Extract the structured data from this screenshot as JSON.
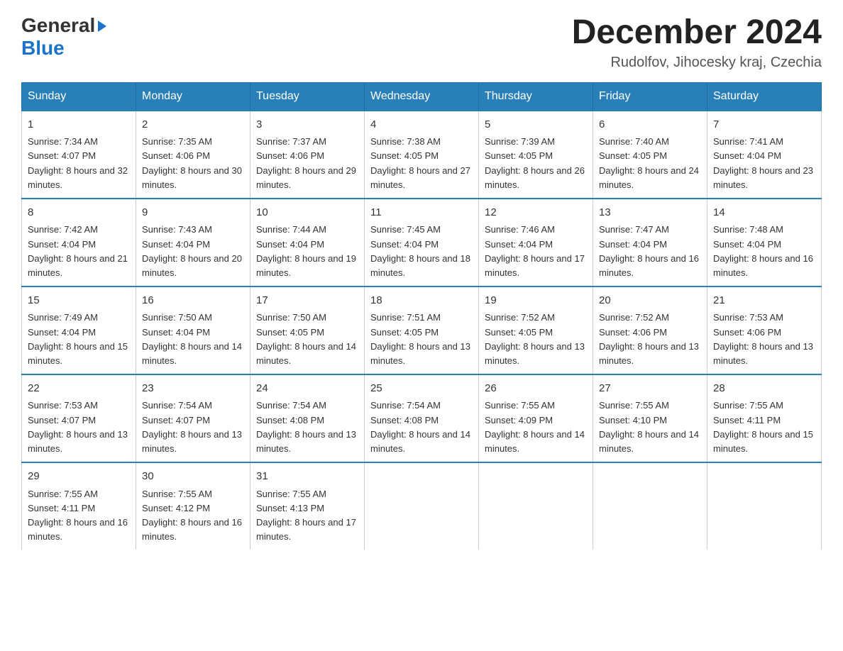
{
  "header": {
    "logo_general": "General",
    "logo_blue": "Blue",
    "month_title": "December 2024",
    "location": "Rudolfov, Jihocesky kraj, Czechia"
  },
  "days_of_week": [
    "Sunday",
    "Monday",
    "Tuesday",
    "Wednesday",
    "Thursday",
    "Friday",
    "Saturday"
  ],
  "weeks": [
    [
      {
        "num": "1",
        "sunrise": "7:34 AM",
        "sunset": "4:07 PM",
        "daylight": "8 hours and 32 minutes."
      },
      {
        "num": "2",
        "sunrise": "7:35 AM",
        "sunset": "4:06 PM",
        "daylight": "8 hours and 30 minutes."
      },
      {
        "num": "3",
        "sunrise": "7:37 AM",
        "sunset": "4:06 PM",
        "daylight": "8 hours and 29 minutes."
      },
      {
        "num": "4",
        "sunrise": "7:38 AM",
        "sunset": "4:05 PM",
        "daylight": "8 hours and 27 minutes."
      },
      {
        "num": "5",
        "sunrise": "7:39 AM",
        "sunset": "4:05 PM",
        "daylight": "8 hours and 26 minutes."
      },
      {
        "num": "6",
        "sunrise": "7:40 AM",
        "sunset": "4:05 PM",
        "daylight": "8 hours and 24 minutes."
      },
      {
        "num": "7",
        "sunrise": "7:41 AM",
        "sunset": "4:04 PM",
        "daylight": "8 hours and 23 minutes."
      }
    ],
    [
      {
        "num": "8",
        "sunrise": "7:42 AM",
        "sunset": "4:04 PM",
        "daylight": "8 hours and 21 minutes."
      },
      {
        "num": "9",
        "sunrise": "7:43 AM",
        "sunset": "4:04 PM",
        "daylight": "8 hours and 20 minutes."
      },
      {
        "num": "10",
        "sunrise": "7:44 AM",
        "sunset": "4:04 PM",
        "daylight": "8 hours and 19 minutes."
      },
      {
        "num": "11",
        "sunrise": "7:45 AM",
        "sunset": "4:04 PM",
        "daylight": "8 hours and 18 minutes."
      },
      {
        "num": "12",
        "sunrise": "7:46 AM",
        "sunset": "4:04 PM",
        "daylight": "8 hours and 17 minutes."
      },
      {
        "num": "13",
        "sunrise": "7:47 AM",
        "sunset": "4:04 PM",
        "daylight": "8 hours and 16 minutes."
      },
      {
        "num": "14",
        "sunrise": "7:48 AM",
        "sunset": "4:04 PM",
        "daylight": "8 hours and 16 minutes."
      }
    ],
    [
      {
        "num": "15",
        "sunrise": "7:49 AM",
        "sunset": "4:04 PM",
        "daylight": "8 hours and 15 minutes."
      },
      {
        "num": "16",
        "sunrise": "7:50 AM",
        "sunset": "4:04 PM",
        "daylight": "8 hours and 14 minutes."
      },
      {
        "num": "17",
        "sunrise": "7:50 AM",
        "sunset": "4:05 PM",
        "daylight": "8 hours and 14 minutes."
      },
      {
        "num": "18",
        "sunrise": "7:51 AM",
        "sunset": "4:05 PM",
        "daylight": "8 hours and 13 minutes."
      },
      {
        "num": "19",
        "sunrise": "7:52 AM",
        "sunset": "4:05 PM",
        "daylight": "8 hours and 13 minutes."
      },
      {
        "num": "20",
        "sunrise": "7:52 AM",
        "sunset": "4:06 PM",
        "daylight": "8 hours and 13 minutes."
      },
      {
        "num": "21",
        "sunrise": "7:53 AM",
        "sunset": "4:06 PM",
        "daylight": "8 hours and 13 minutes."
      }
    ],
    [
      {
        "num": "22",
        "sunrise": "7:53 AM",
        "sunset": "4:07 PM",
        "daylight": "8 hours and 13 minutes."
      },
      {
        "num": "23",
        "sunrise": "7:54 AM",
        "sunset": "4:07 PM",
        "daylight": "8 hours and 13 minutes."
      },
      {
        "num": "24",
        "sunrise": "7:54 AM",
        "sunset": "4:08 PM",
        "daylight": "8 hours and 13 minutes."
      },
      {
        "num": "25",
        "sunrise": "7:54 AM",
        "sunset": "4:08 PM",
        "daylight": "8 hours and 14 minutes."
      },
      {
        "num": "26",
        "sunrise": "7:55 AM",
        "sunset": "4:09 PM",
        "daylight": "8 hours and 14 minutes."
      },
      {
        "num": "27",
        "sunrise": "7:55 AM",
        "sunset": "4:10 PM",
        "daylight": "8 hours and 14 minutes."
      },
      {
        "num": "28",
        "sunrise": "7:55 AM",
        "sunset": "4:11 PM",
        "daylight": "8 hours and 15 minutes."
      }
    ],
    [
      {
        "num": "29",
        "sunrise": "7:55 AM",
        "sunset": "4:11 PM",
        "daylight": "8 hours and 16 minutes."
      },
      {
        "num": "30",
        "sunrise": "7:55 AM",
        "sunset": "4:12 PM",
        "daylight": "8 hours and 16 minutes."
      },
      {
        "num": "31",
        "sunrise": "7:55 AM",
        "sunset": "4:13 PM",
        "daylight": "8 hours and 17 minutes."
      },
      null,
      null,
      null,
      null
    ]
  ]
}
